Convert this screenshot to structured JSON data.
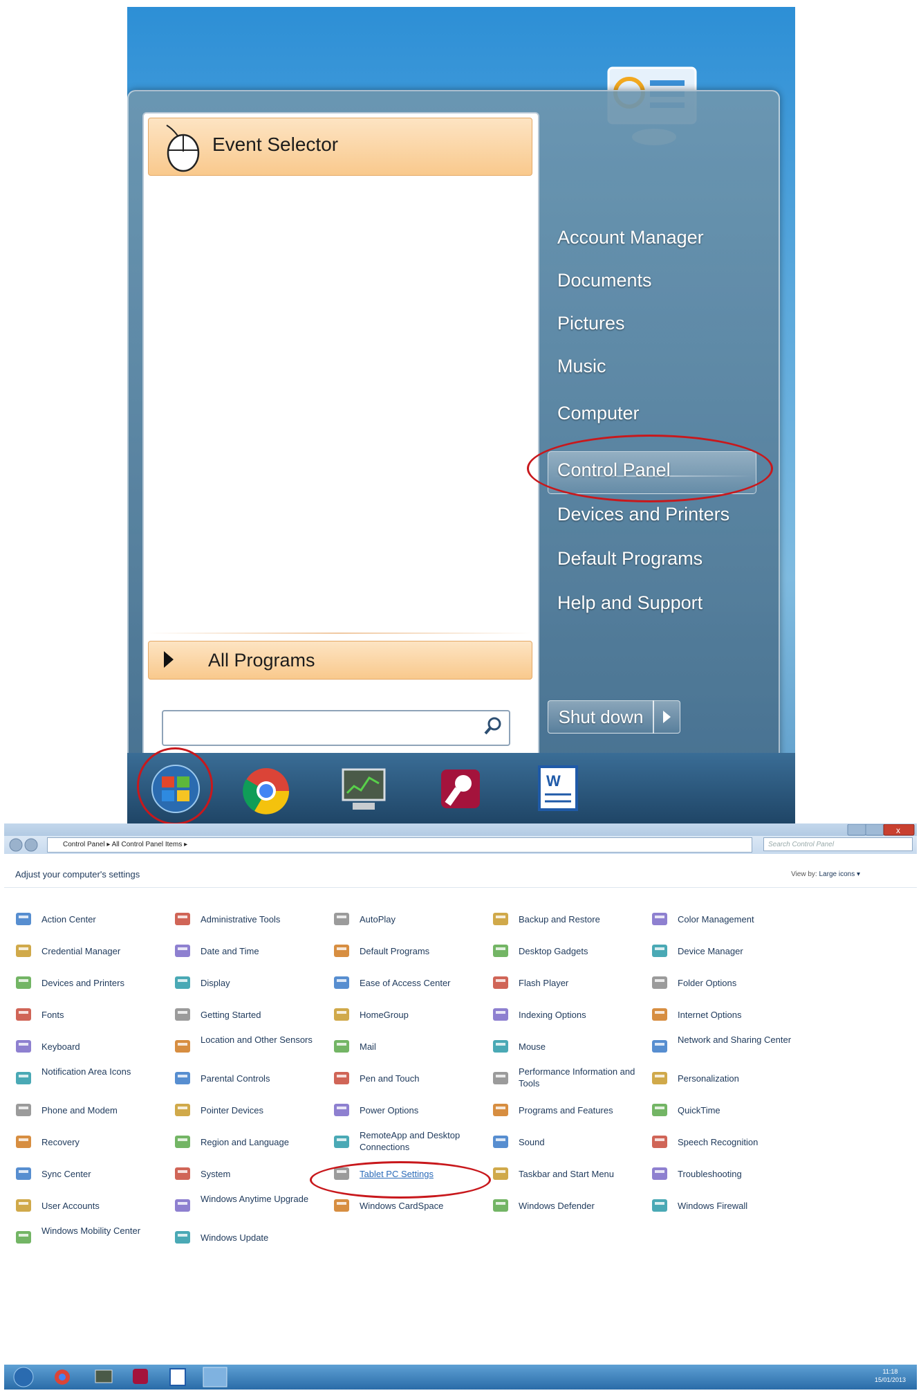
{
  "start_menu": {
    "pinned_program": "Event Selector",
    "all_programs": "All Programs",
    "search_placeholder": "",
    "right_items": [
      "Account Manager",
      "Documents",
      "Pictures",
      "Music",
      "Computer",
      "Control Panel",
      "Devices and Printers",
      "Default Programs",
      "Help and Support"
    ],
    "shutdown_label": "Shut down",
    "highlighted_item": "Control Panel"
  },
  "start_taskbar": {
    "icons": [
      "windows-start-orb-icon",
      "chrome-icon",
      "monitor-chart-icon",
      "access-key-icon",
      "word-icon"
    ]
  },
  "control_panel": {
    "breadcrumb": "Control Panel ▸ All Control Panel Items ▸",
    "search_placeholder": "Search Control Panel",
    "heading": "Adjust your computer's settings",
    "view_by_label": "View by:",
    "view_by_value": "Large icons ▾",
    "columns": [
      [
        "Action Center",
        "Credential Manager",
        "Devices and Printers",
        "Fonts",
        "Keyboard",
        "Notification Area Icons",
        "Phone and Modem",
        "Recovery",
        "Sync Center",
        "User Accounts",
        "Windows Mobility Center"
      ],
      [
        "Administrative Tools",
        "Date and Time",
        "Display",
        "Getting Started",
        "Location and Other Sensors",
        "Parental Controls",
        "Pointer Devices",
        "Region and Language",
        "System",
        "Windows Anytime Upgrade",
        "Windows Update"
      ],
      [
        "AutoPlay",
        "Default Programs",
        "Ease of Access Center",
        "HomeGroup",
        "Mail",
        "Pen and Touch",
        "Power Options",
        "RemoteApp and Desktop Connections",
        "Tablet PC Settings",
        "Windows CardSpace"
      ],
      [
        "Backup and Restore",
        "Desktop Gadgets",
        "Flash Player",
        "Indexing Options",
        "Mouse",
        "Performance Information and Tools",
        "Programs and Features",
        "Sound",
        "Taskbar and Start Menu",
        "Windows Defender"
      ],
      [
        "Color Management",
        "Device Manager",
        "Folder Options",
        "Internet Options",
        "Network and Sharing Center",
        "Personalization",
        "QuickTime",
        "Speech Recognition",
        "Troubleshooting",
        "Windows Firewall"
      ]
    ],
    "highlighted_item": "Tablet PC Settings",
    "clock_time": "11:18",
    "clock_date": "15/01/2013"
  },
  "colors": {
    "highlight_red": "#c8181c",
    "item_text": "#1e395b",
    "menu_orange": "#f9c98d"
  }
}
